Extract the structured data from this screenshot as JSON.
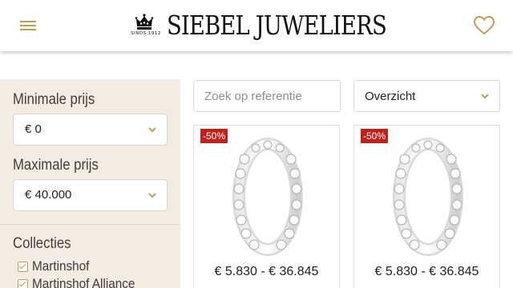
{
  "header": {
    "brand_name": "SIEBEL JUWELIERS",
    "brand_tagline": "SINDS 1912",
    "menu_icon": "hamburger-icon",
    "wishlist_icon": "heart-icon"
  },
  "sidebar": {
    "min_price": {
      "label": "Minimale prijs",
      "value": "€ 0"
    },
    "max_price": {
      "label": "Maximale prijs",
      "value": "€ 40.000"
    },
    "collections": {
      "label": "Collecties",
      "items": [
        {
          "label": "Martinshof",
          "checked": true
        },
        {
          "label": "Martinshof Alliance",
          "checked": true
        }
      ]
    }
  },
  "toolbar": {
    "search_placeholder": "Zoek op referentie",
    "view_value": "Overzicht"
  },
  "products": [
    {
      "badge": "-50%",
      "price": "€ 5.830 - € 36.845"
    },
    {
      "badge": "-50%",
      "price": "€ 5.830 - € 36.845"
    }
  ],
  "colors": {
    "accent_gold": "#c69a52",
    "sidebar_bg": "#f4ece2",
    "sale_badge": "#c2201b"
  }
}
